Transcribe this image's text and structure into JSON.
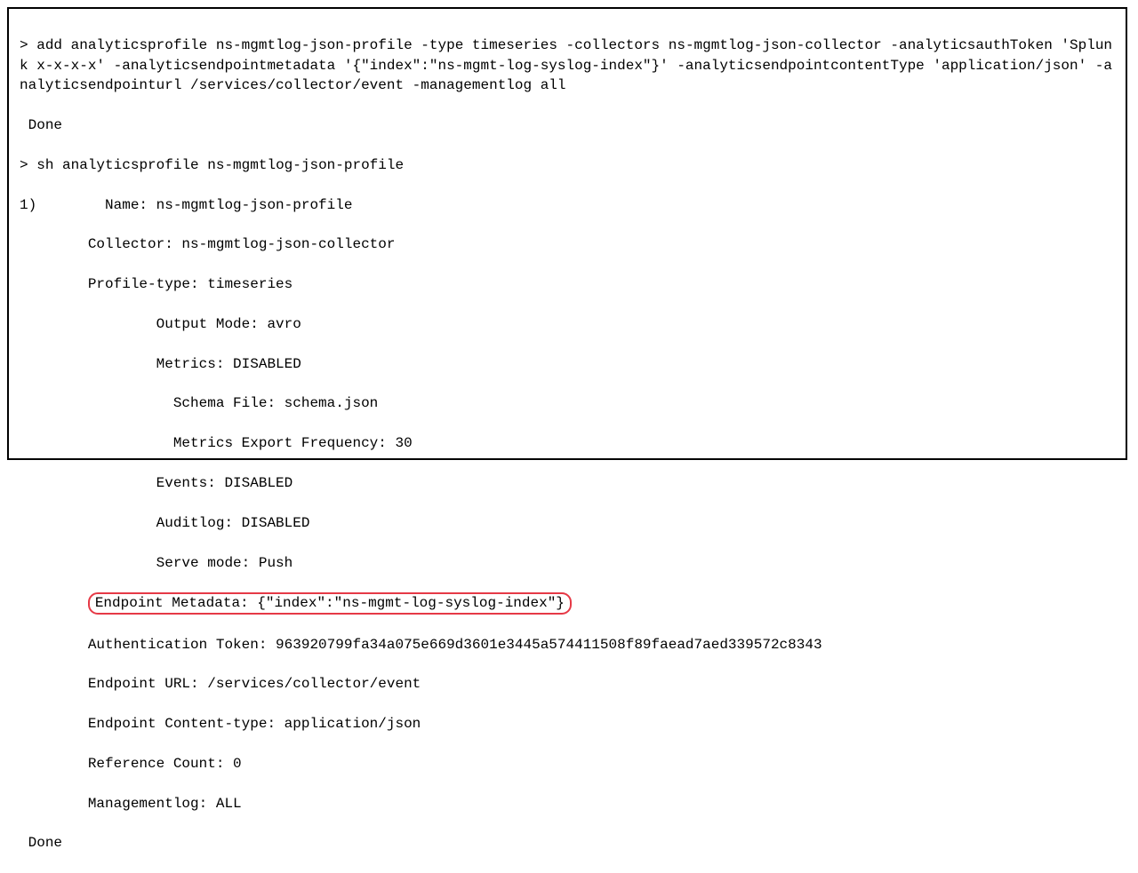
{
  "terminal": {
    "prompt": ">",
    "cmd_add": "add analyticsprofile ns-mgmtlog-json-profile -type timeseries -collectors ns-mgmtlog-json-collector -analyticsauthToken 'Splunk x-x-x-x' -analyticsendpointmetadata '{\"index\":\"ns-mgmt-log-syslog-index\"}' -analyticsendpointcontentType 'application/json' -analyticsendpointurl /services/collector/event -managementlog all",
    "done1": " Done",
    "cmd_sh": "sh analyticsprofile ns-mgmtlog-json-profile",
    "idx": "1)",
    "name_line": "        Name: ns-mgmtlog-json-profile",
    "collector_line": "        Collector: ns-mgmtlog-json-collector",
    "profile_type": "        Profile-type: timeseries",
    "output_mode": "                Output Mode: avro",
    "metrics": "                Metrics: DISABLED",
    "schema_file": "                  Schema File: schema.json",
    "metrics_freq": "                  Metrics Export Frequency: 30",
    "events": "                Events: DISABLED",
    "auditlog": "                Auditlog: DISABLED",
    "serve_mode": "                Serve mode: Push",
    "endpoint_meta": "Endpoint Metadata: {\"index\":\"ns-mgmt-log-syslog-index\"}",
    "auth_token": "        Authentication Token: 963920799fa34a075e669d3601e3445a574411508f89faead7aed339572c8343",
    "endpoint_url": "        Endpoint URL: /services/collector/event",
    "endpoint_ct": "        Endpoint Content-type: application/json",
    "ref_count": "        Reference Count: 0",
    "mgmt_log": "        Managementlog: ALL",
    "done2": " Done",
    "indent8": "        "
  }
}
